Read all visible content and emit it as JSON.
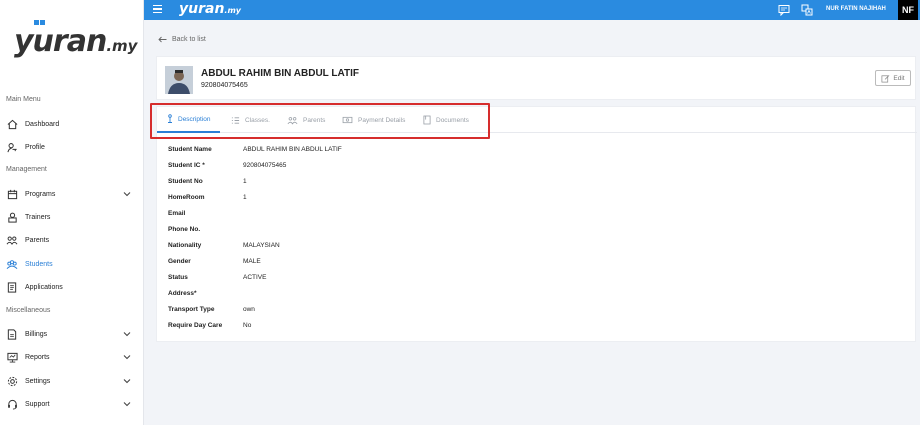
{
  "app": {
    "logo_main": "yuran",
    "logo_tld": ".my"
  },
  "topbar": {
    "user_name": "NUR FATIN NAJIHAH",
    "user_initials": "NF"
  },
  "sidebar": {
    "sections": [
      {
        "label": "Main Menu"
      },
      {
        "label": "Management"
      },
      {
        "label": "Miscellaneous"
      }
    ],
    "items": [
      {
        "label": "Dashboard",
        "icon": "home-icon"
      },
      {
        "label": "Profile",
        "icon": "profile-key-icon"
      },
      {
        "label": "Programs",
        "icon": "calendar-icon",
        "expandable": true
      },
      {
        "label": "Trainers",
        "icon": "trainer-icon"
      },
      {
        "label": "Parents",
        "icon": "parents-icon"
      },
      {
        "label": "Students",
        "icon": "students-icon",
        "active": true
      },
      {
        "label": "Applications",
        "icon": "document-icon"
      },
      {
        "label": "Billings",
        "icon": "billing-icon",
        "expandable": true
      },
      {
        "label": "Reports",
        "icon": "reports-icon",
        "expandable": true
      },
      {
        "label": "Settings",
        "icon": "gear-icon",
        "expandable": true
      },
      {
        "label": "Support",
        "icon": "headset-icon",
        "expandable": true
      }
    ]
  },
  "page": {
    "back_label": "Back to list",
    "student_name": "ABDUL RAHIM BIN ABDUL LATIF",
    "student_ic": "920804075465",
    "edit_label": "Edit"
  },
  "tabs": [
    {
      "label": "Description",
      "icon": "description-icon",
      "active": true
    },
    {
      "label": "Classes.",
      "icon": "list-icon"
    },
    {
      "label": "Parents",
      "icon": "parents-icon"
    },
    {
      "label": "Payment Details",
      "icon": "payment-icon"
    },
    {
      "label": "Documents",
      "icon": "documents-icon"
    }
  ],
  "details": [
    {
      "label": "Student Name",
      "value": "ABDUL RAHIM BIN ABDUL LATIF"
    },
    {
      "label": "Student IC *",
      "value": "920804075465"
    },
    {
      "label": "Student No",
      "value": "1"
    },
    {
      "label": "HomeRoom",
      "value": "1"
    },
    {
      "label": "Email",
      "value": ""
    },
    {
      "label": "Phone No.",
      "value": ""
    },
    {
      "label": "Nationality",
      "value": "MALAYSIAN"
    },
    {
      "label": "Gender",
      "value": "MALE"
    },
    {
      "label": "Status",
      "value": "ACTIVE"
    },
    {
      "label": "Address*",
      "value": ""
    },
    {
      "label": "Transport Type",
      "value": "own"
    },
    {
      "label": "Require Day Care",
      "value": "No"
    }
  ],
  "colors": {
    "primary": "#2a8be0",
    "active": "#2a7fd6",
    "highlight": "#d62d2d"
  }
}
